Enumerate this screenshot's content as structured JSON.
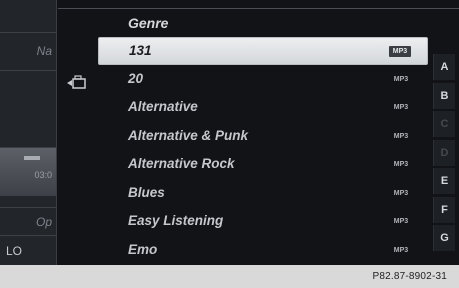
{
  "header": {
    "title": "Genre"
  },
  "left_menu": {
    "item_top": "Na",
    "item_mid_value": "03:0",
    "item_op": "Op",
    "item_lo": "LO"
  },
  "list": {
    "items": [
      {
        "label": "131",
        "format": "MP3",
        "selected": true
      },
      {
        "label": "20",
        "format": "MP3",
        "selected": false
      },
      {
        "label": "Alternative",
        "format": "MP3",
        "selected": false
      },
      {
        "label": "Alternative & Punk",
        "format": "MP3",
        "selected": false
      },
      {
        "label": "Alternative Rock",
        "format": "MP3",
        "selected": false
      },
      {
        "label": "Blues",
        "format": "MP3",
        "selected": false
      },
      {
        "label": "Easy Listening",
        "format": "MP3",
        "selected": false
      },
      {
        "label": "Emo",
        "format": "MP3",
        "selected": false
      }
    ]
  },
  "alphabet": [
    "A",
    "B",
    "C",
    "D",
    "E",
    "F",
    "G"
  ],
  "caption": "P82.87-8902-31",
  "icons": {
    "back": "folder-back-icon"
  }
}
